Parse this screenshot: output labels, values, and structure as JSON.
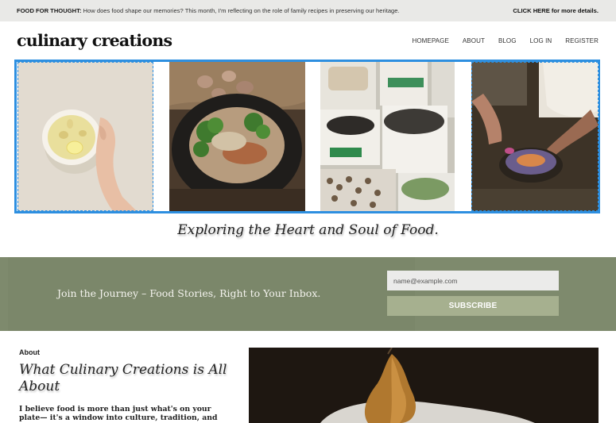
{
  "announcement": {
    "lead": "FOOD FOR THOUGHT:",
    "text": "How does food shape our memories? This month, I'm reflecting on the role of family recipes in preserving our heritage.",
    "cta": "CLICK HERE for more details."
  },
  "header": {
    "logo": "culinary creations",
    "nav": [
      "HOMEPAGE",
      "ABOUT",
      "BLOG",
      "LOG IN",
      "REGISTER"
    ]
  },
  "gallery": {
    "accent_color": "#2d8fe0",
    "images": [
      "ginger-tea-photo",
      "grain-bowl-photo",
      "market-sacks-photo",
      "cooking-hands-photo"
    ]
  },
  "tagline": "Exploring the Heart and Soul of Food.",
  "newsletter": {
    "background": "#7e8a6d",
    "heading": "Join the Journey – Food Stories, Right to Your Inbox.",
    "email_placeholder": "name@example.com",
    "subscribe_label": "SUBSCRIBE"
  },
  "about": {
    "label": "About",
    "title": "What Culinary Creations is All About",
    "body": "I believe food is more than just what's on your plate— it's a window into culture, tradition, and connection.",
    "image": "pear-still-life-photo"
  }
}
